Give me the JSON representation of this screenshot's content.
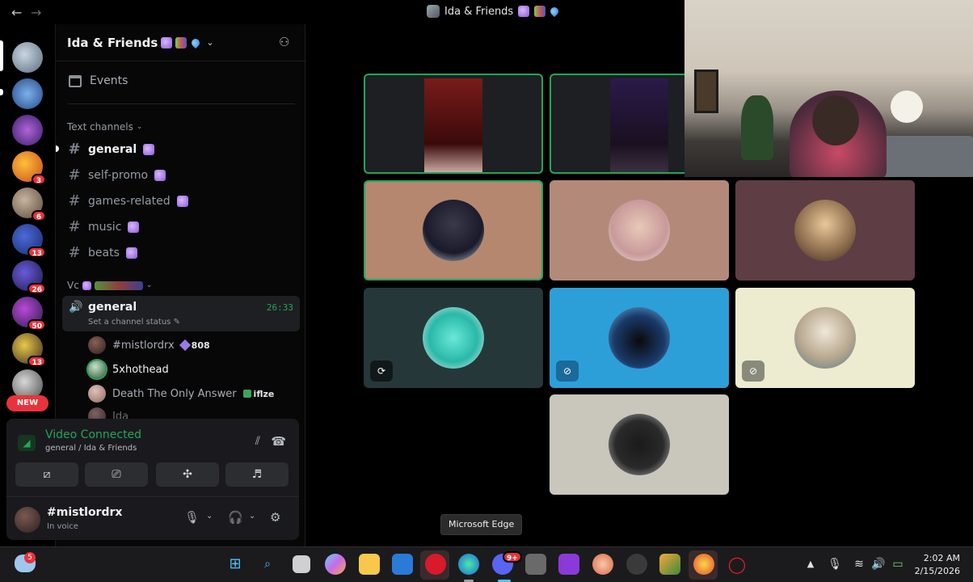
{
  "window": {
    "title": "Ida & Friends",
    "nav_back": "←",
    "nav_forward": "→"
  },
  "rail": {
    "badges": [
      "3",
      "6",
      "13",
      "26",
      "50",
      "13"
    ],
    "new_label": "NEW"
  },
  "sidebar": {
    "server_name": "Ida & Friends",
    "events_label": "Events",
    "text_category": "Text channels",
    "channels": [
      {
        "name": "general",
        "active": true
      },
      {
        "name": "self-promo"
      },
      {
        "name": "games-related"
      },
      {
        "name": "music"
      },
      {
        "name": "beats"
      }
    ],
    "voice_category": "Vc",
    "voice_channel": {
      "name": "general",
      "timer": "26:33",
      "status": "Set a channel status"
    },
    "voice_users": [
      {
        "name": "#mistlordrx",
        "tag": "808"
      },
      {
        "name": "5xhothead"
      },
      {
        "name": "Death The Only Answer",
        "tag": "iflze"
      },
      {
        "name": "Ida"
      }
    ]
  },
  "video_panel": {
    "title": "Video Connected",
    "subtitle": "general / Ida & Friends"
  },
  "user_panel": {
    "name": "#mistlordrx",
    "status": "In voice"
  },
  "tooltip": "Microsoft Edge",
  "taskbar": {
    "weather_badge": "5",
    "discord_badge": "9+",
    "time": "2:02 AM",
    "date": "2/15/2026"
  }
}
